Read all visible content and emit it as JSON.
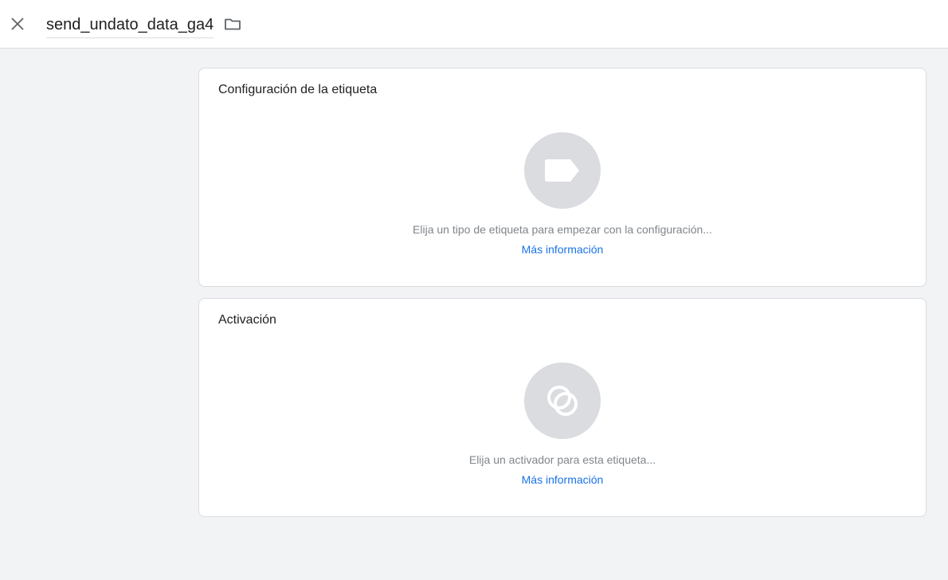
{
  "header": {
    "tag_name": "send_undato_data_ga4",
    "close_icon": "close-icon",
    "folder_icon": "folder-icon"
  },
  "tag_config": {
    "title": "Configuración de la etiqueta",
    "icon": "tag-icon",
    "hint": "Elija un tipo de etiqueta para empezar con la configuración...",
    "learn_more": "Más información"
  },
  "triggering": {
    "title": "Activación",
    "icon": "trigger-icon",
    "hint": "Elija un activador para esta etiqueta...",
    "learn_more": "Más información"
  },
  "colors": {
    "accent": "#1a73e8",
    "background": "#f1f3f4",
    "placeholder_circle": "#dadce0"
  }
}
